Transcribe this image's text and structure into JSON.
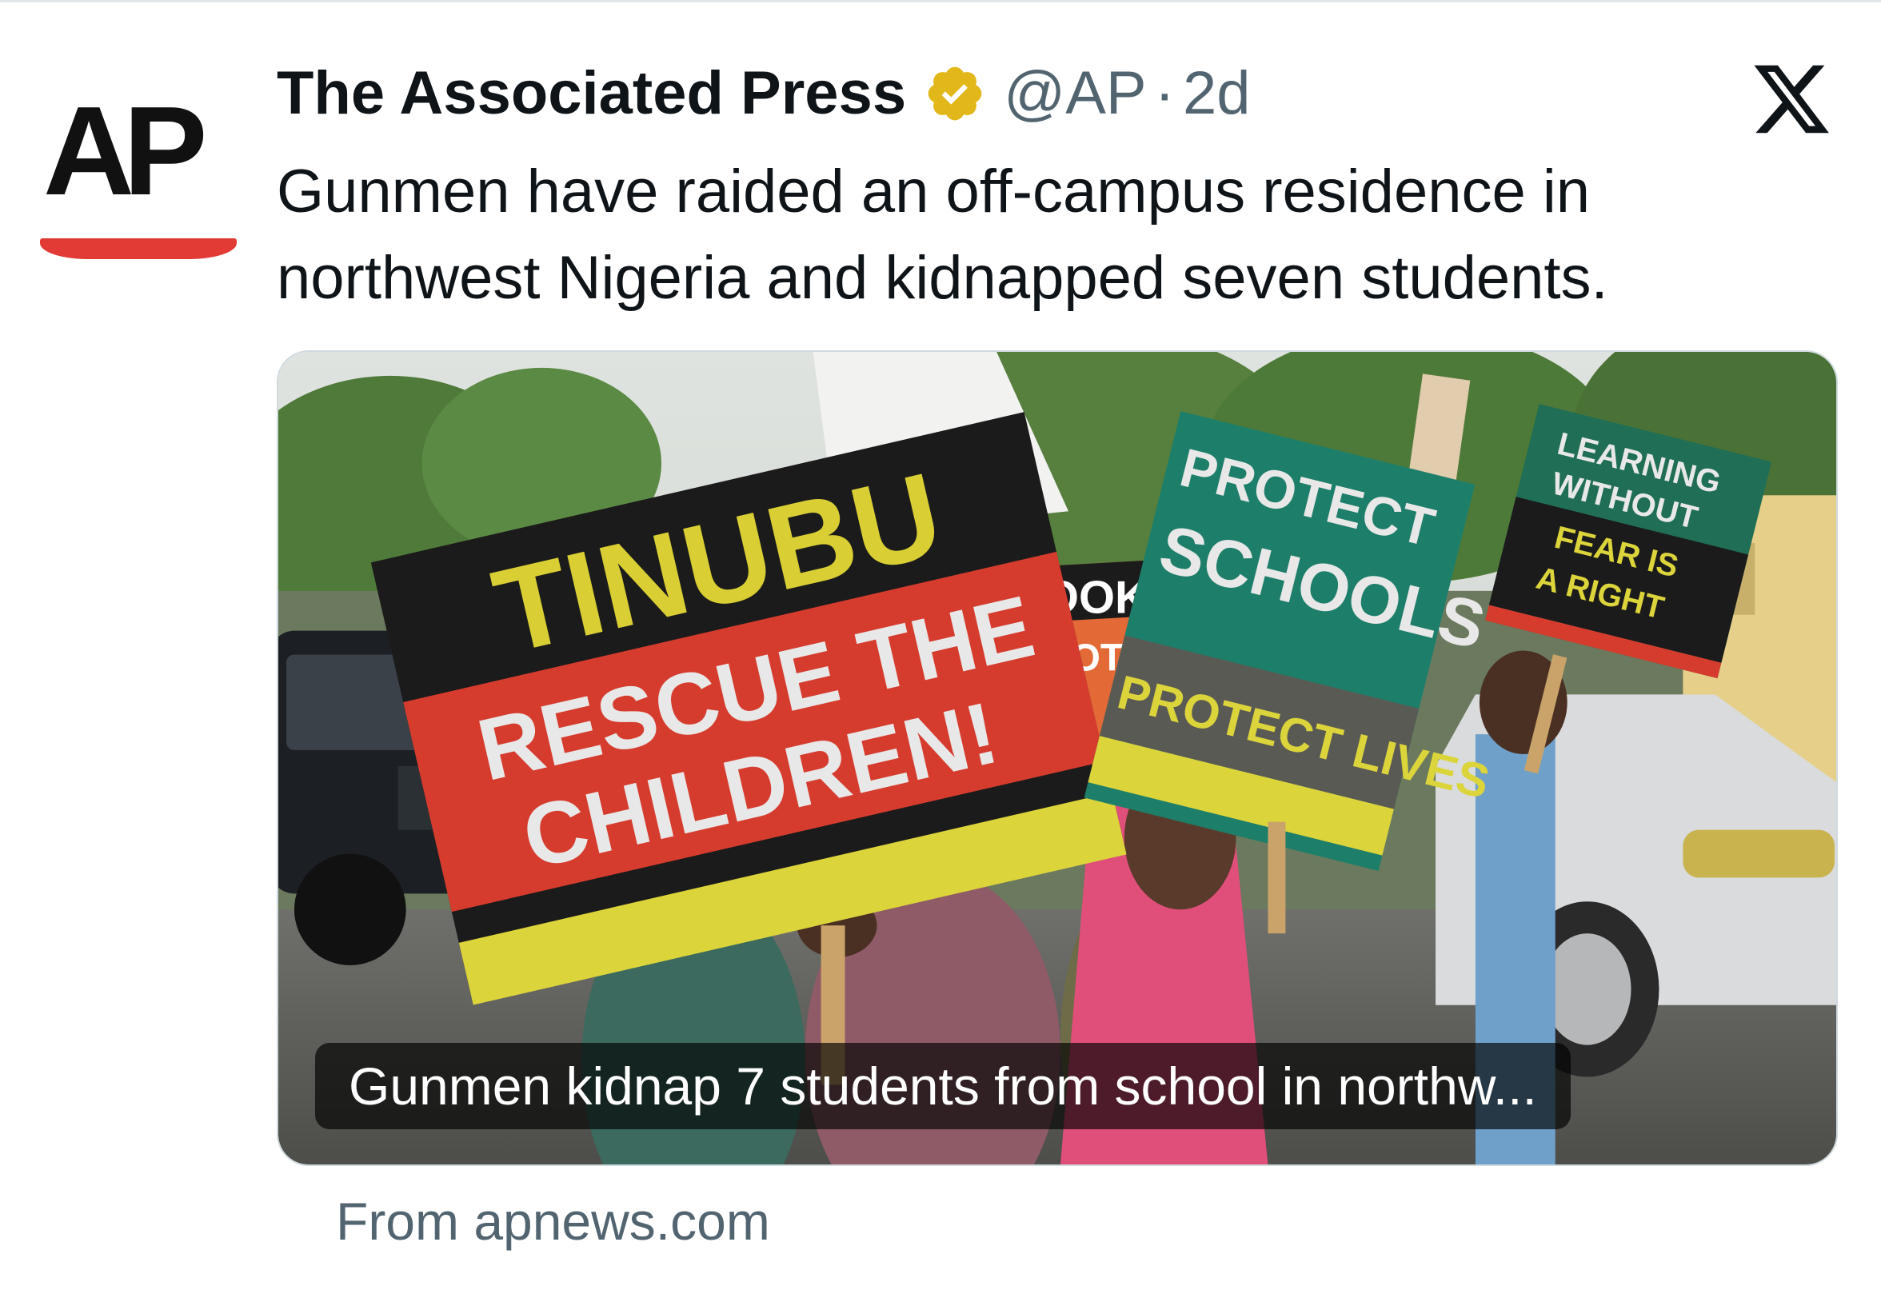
{
  "tweet": {
    "logo_text": "AP",
    "author_name": "The Associated Press",
    "handle": "@AP",
    "separator": "·",
    "time": "2d",
    "text_line1": "Gunmen have raided an off-campus residence in",
    "text_line2": "northwest Nigeria and kidnapped seven students."
  },
  "card": {
    "caption": "Gunmen kidnap 7 students from school in northw...",
    "source": "From apnews.com",
    "signs": {
      "main_top": "TINUBU",
      "main_mid1": "RESCUE THE",
      "main_mid2": "CHILDREN!",
      "green_line1": "PROTECT",
      "green_line2": "SCHOOLS",
      "green_line3": "PROTECT LIVES",
      "right_line1": "LEARNING",
      "right_line2": "WITHOUT",
      "right_line3": "FEAR IS",
      "right_line4": "A RIGHT",
      "back_partial1": "OOKS",
      "back_partial2": "NOT"
    }
  },
  "icons": {
    "verified": "verified-badge-icon",
    "platform": "x-logo-icon"
  },
  "colors": {
    "ap_red": "#e23b35",
    "verified_gold": "#e2b719",
    "text_primary": "#0f1419",
    "text_secondary": "#536471"
  }
}
